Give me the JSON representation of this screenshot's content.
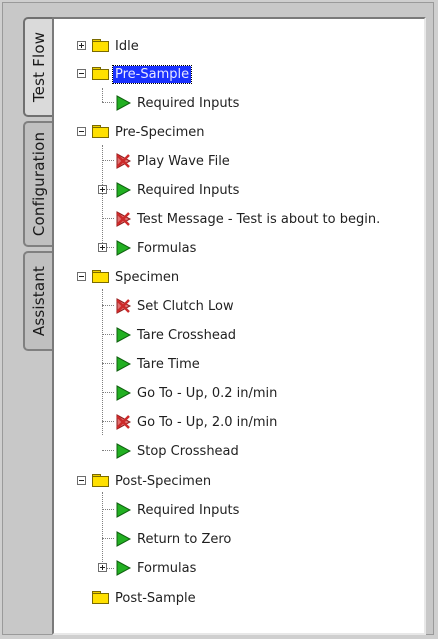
{
  "tabs": {
    "test_flow": "Test Flow",
    "configuration": "Configuration",
    "assistant": "Assistant"
  },
  "tree": {
    "idle": "Idle",
    "pre_sample": "Pre-Sample",
    "pre_sample_required": "Required Inputs",
    "pre_specimen": "Pre-Specimen",
    "play_wave": "Play Wave File",
    "pre_spec_required": "Required Inputs",
    "test_message": "Test Message - Test is about to begin.",
    "pre_spec_formulas": "Formulas",
    "specimen": "Specimen",
    "set_clutch": "Set Clutch Low",
    "tare_crosshead": "Tare Crosshead",
    "tare_time": "Tare Time",
    "goto_up_02": "Go To - Up, 0.2 in/min",
    "goto_up_20": "Go To - Up, 2.0 in/min",
    "stop_crosshead": "Stop Crosshead",
    "post_specimen": "Post-Specimen",
    "post_spec_required": "Required Inputs",
    "return_zero": "Return to Zero",
    "post_spec_formulas": "Formulas",
    "post_sample": "Post-Sample"
  },
  "colors": {
    "selection": "#1a32ff",
    "folder": "#ffe000",
    "action_enabled": "#22b022",
    "action_disabled": "#cc2a2a"
  },
  "icons": {
    "folder": "folder-icon",
    "action": "play-triangle-icon",
    "disabled_action": "disabled-action-icon",
    "expand": "expand-icon",
    "collapse": "collapse-icon"
  }
}
